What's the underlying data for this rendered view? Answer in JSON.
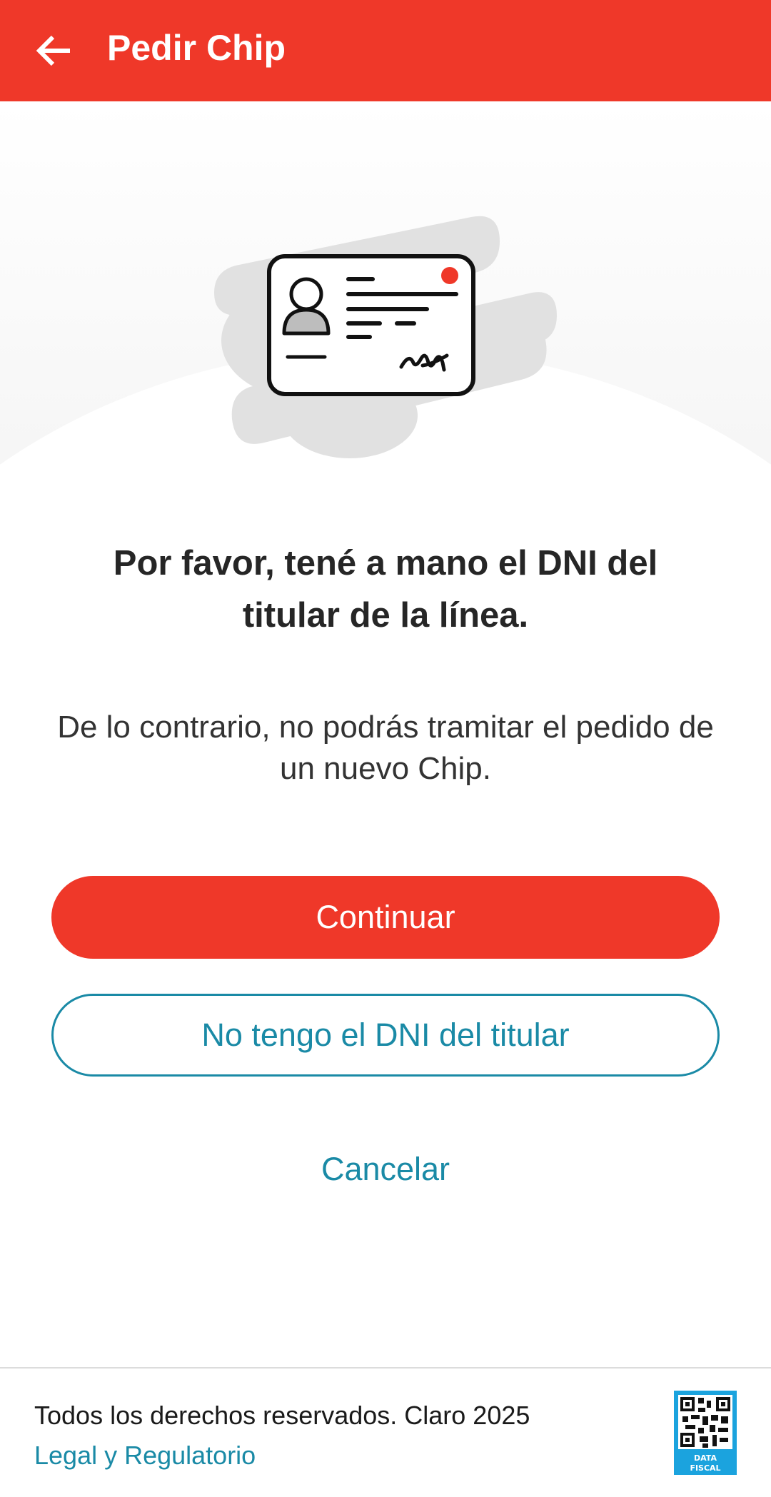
{
  "header": {
    "title": "Pedir Chip",
    "back_icon": "arrow-left-icon",
    "background_color": "#ef3829"
  },
  "hero": {
    "illustration_icon": "id-card-icon"
  },
  "content": {
    "heading": "Por favor, tené a mano el DNI del titular de la línea.",
    "description": "De lo contrario, no podrás tramitar el pedido de un nuevo Chip."
  },
  "actions": {
    "continue_label": "Continuar",
    "no_dni_label": "No tengo el DNI del titular",
    "cancel_label": "Cancelar",
    "primary_color": "#ef3829",
    "link_color": "#1a8aa6"
  },
  "footer": {
    "copyright": "Todos los derechos reservados. Claro 2025",
    "legal_link": "Legal y Regulatorio",
    "badge_icon": "data-fiscal-qr-icon",
    "badge_text_line1": "DATA",
    "badge_text_line2": "FISCAL"
  }
}
